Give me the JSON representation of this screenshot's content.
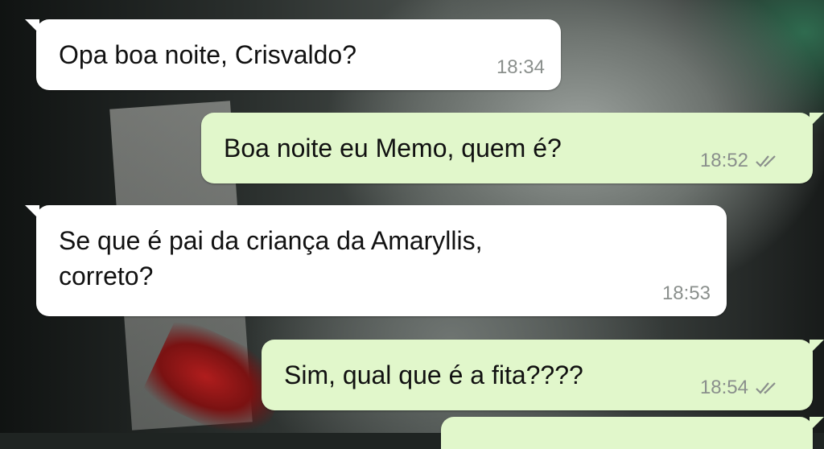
{
  "messages": [
    {
      "direction": "in",
      "text": "Opa boa noite, Crisvaldo?",
      "time": "18:34"
    },
    {
      "direction": "out",
      "text": "Boa noite eu Memo, quem é?",
      "time": "18:52",
      "status_icon": "double-check-icon"
    },
    {
      "direction": "in",
      "text": "Se que é pai da criança da Amaryllis,\ncorreto?",
      "time": "18:53"
    },
    {
      "direction": "out",
      "text": "Sim, qual que é a fita????",
      "time": "18:54",
      "status_icon": "double-check-icon"
    }
  ],
  "colors": {
    "incoming_bubble": "#ffffff",
    "outgoing_bubble": "#e1f7cb",
    "timestamp": "#8a8f8c"
  }
}
